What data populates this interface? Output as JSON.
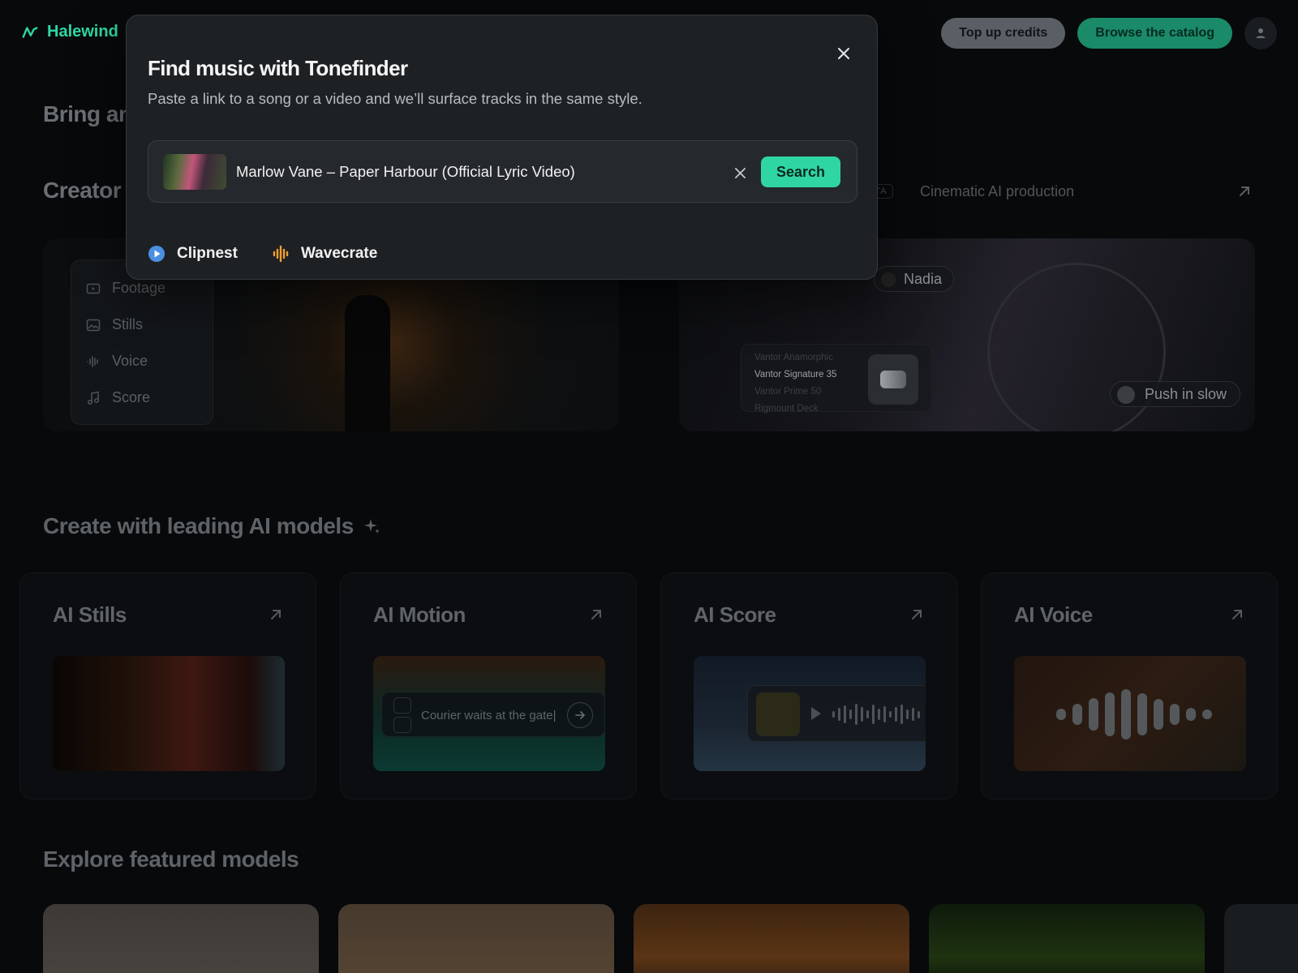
{
  "header": {
    "brand": "Halewind",
    "top_up_label": "Top up credits",
    "browse_label": "Browse the catalog"
  },
  "page": {
    "bring_heading": "Bring any",
    "creator_heading": "Creator",
    "beta_tag": "ETA",
    "cinematic_link": "Cinematic AI production",
    "hero_left_menu": [
      "Footage",
      "Stills",
      "Voice",
      "Score"
    ],
    "hero_right": {
      "character_chip": "Nadia",
      "lenses": [
        "Vantor Anamorphic",
        "Vantor Signature 35",
        "Vantor Prime 50",
        "Rigmount Deck"
      ],
      "selected_lens": "Vantor Signature 35",
      "move_chip": "Push in slow"
    },
    "models_heading": "Create with leading AI models",
    "model_cards": [
      {
        "title": "AI Stills"
      },
      {
        "title": "AI Motion",
        "prompt": "Courier waits at the gate|"
      },
      {
        "title": "AI Score"
      },
      {
        "title": "AI Voice"
      }
    ],
    "featured_heading": "Explore featured models"
  },
  "modal": {
    "title": "Find music with Tonefinder",
    "subtitle": "Paste a link to a song or a video and we’ll surface tracks in the same style.",
    "search_value": "Marlow Vane – Paper Harbour (Official Lyric Video)",
    "search_button": "Search",
    "sources": [
      "Clipnest",
      "Wavecrate"
    ]
  },
  "colors": {
    "accent": "#2fd6a4",
    "clipnest_icon": "#4a90e2",
    "wavecrate_icon": "#f0a030"
  },
  "icons": {
    "brand": "halewind-logo-icon",
    "close": "close-icon",
    "clear": "clear-icon",
    "clipnest": "play-circle-icon",
    "wavecrate": "waveform-icon",
    "sparkle": "sparkle-icon",
    "arrow": "arrow-up-right-icon"
  }
}
